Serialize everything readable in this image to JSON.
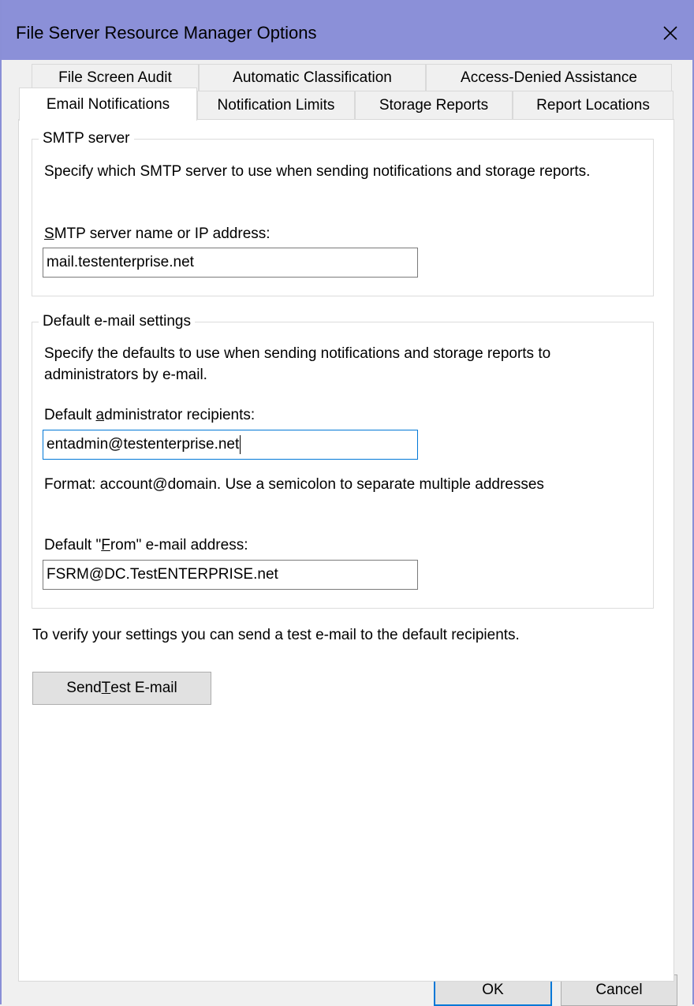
{
  "window": {
    "title": "File Server Resource Manager Options"
  },
  "tabs": {
    "row1": [
      {
        "label": "File Screen Audit"
      },
      {
        "label": "Automatic Classification"
      },
      {
        "label": "Access-Denied Assistance"
      }
    ],
    "row2": [
      {
        "label": "Email Notifications",
        "selected": true
      },
      {
        "label": "Notification Limits"
      },
      {
        "label": "Storage Reports"
      },
      {
        "label": "Report Locations"
      }
    ]
  },
  "smtp": {
    "group_title": "SMTP server",
    "description": "Specify which SMTP server to use when sending notifications and storage reports.",
    "field_label_accel": "S",
    "field_label_rest": "MTP server name or IP address:",
    "value": "mail.testenterprise.net"
  },
  "email": {
    "group_title": "Default e-mail settings",
    "description": "Specify the defaults to use when sending notifications and storage reports to administrators by e-mail.",
    "recipients_label_pre": "Default ",
    "recipients_label_accel": "a",
    "recipients_label_post": "dministrator recipients:",
    "recipients_value": "entadmin@testenterprise.net",
    "format_hint": "Format: account@domain. Use a semicolon to separate multiple addresses",
    "from_label_pre": "Default \"",
    "from_label_accel": "F",
    "from_label_post": "rom\" e-mail address:",
    "from_value": "FSRM@DC.TestENTERPRISE.net"
  },
  "verify_text": "To verify your settings you can send a test e-mail to the default recipients.",
  "test_button": {
    "pre": "Send ",
    "accel": "T",
    "post": "est E-mail"
  },
  "footer": {
    "ok_label": "OK",
    "cancel_label": "Cancel"
  }
}
